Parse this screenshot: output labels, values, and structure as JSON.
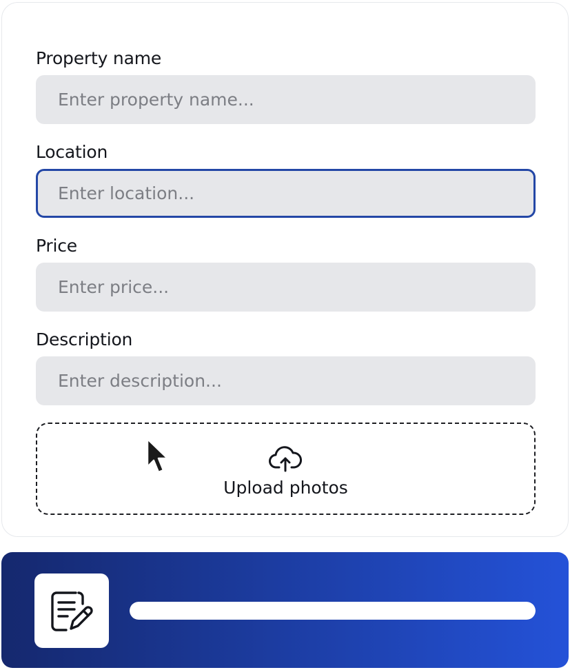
{
  "form": {
    "fields": [
      {
        "label": "Property name",
        "placeholder": "Enter property name...",
        "value": ""
      },
      {
        "label": "Location",
        "placeholder": "Enter location...",
        "value": ""
      },
      {
        "label": "Price",
        "placeholder": "Enter price...",
        "value": ""
      },
      {
        "label": "Description",
        "placeholder": "Enter description...",
        "value": ""
      }
    ],
    "focused_field": "Location",
    "upload": {
      "label": "Upload photos",
      "icon": "cloud-upload-icon"
    }
  },
  "status_bar": {
    "icon": "edit-document-icon",
    "progress": 1.0
  },
  "colors": {
    "input_bg": "#e6e7ea",
    "focus_border": "#2347a6",
    "bar_gradient_start": "#15286e",
    "bar_gradient_end": "#2452d8"
  }
}
